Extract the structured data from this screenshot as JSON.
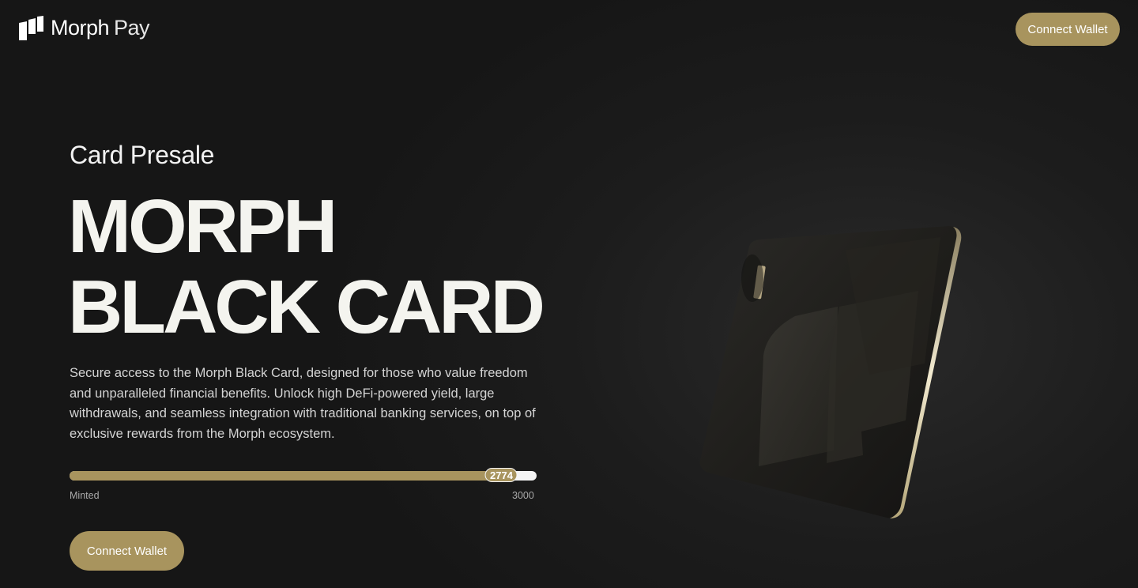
{
  "brand": {
    "name_bold": "Morph",
    "name_light": "Pay",
    "accent_color": "#a8945e",
    "logo_icon": "morph-logo-icon"
  },
  "header": {
    "connect_wallet_label": "Connect Wallet"
  },
  "hero": {
    "eyebrow": "Card Presale",
    "headline_line1": "MORPH",
    "headline_line2": "BLACK CARD",
    "description": "Secure access to the Morph Black Card, designed for those who value freedom and unparalleled financial benefits. Unlock high DeFi-powered yield, large withdrawals, and seamless integration with traditional banking services, on top of exclusive rewards from the Morph ecosystem.",
    "cta_label": "Connect Wallet"
  },
  "progress": {
    "minted": 2774,
    "minted_label": "2774",
    "total": 3000,
    "min_label": "Minted",
    "max_label": "3000"
  }
}
